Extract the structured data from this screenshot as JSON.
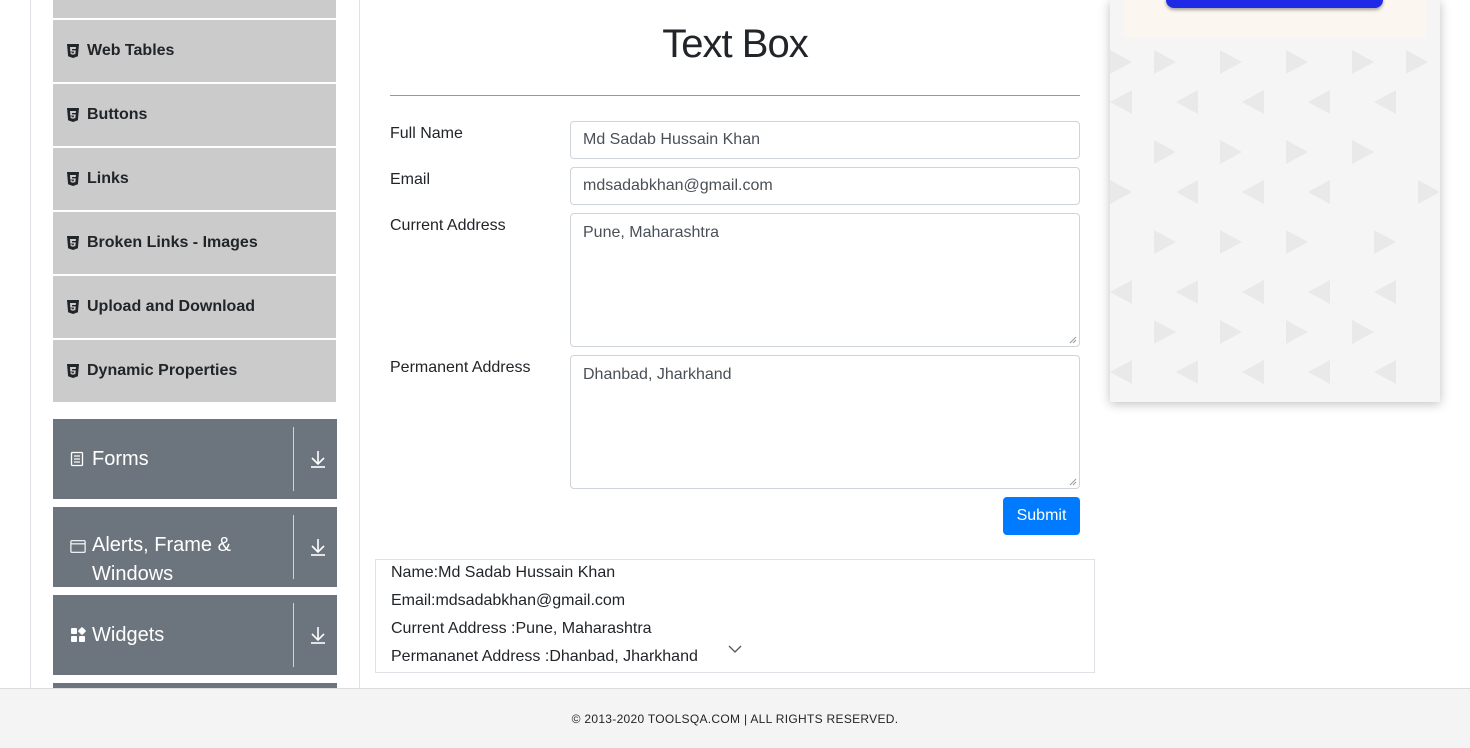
{
  "sidebar": {
    "items": [
      {
        "label": "Web Tables",
        "icon": "html5-icon"
      },
      {
        "label": "Buttons",
        "icon": "html5-icon"
      },
      {
        "label": "Links",
        "icon": "html5-icon"
      },
      {
        "label": "Broken Links - Images",
        "icon": "html5-icon"
      },
      {
        "label": "Upload and Download",
        "icon": "html5-icon"
      },
      {
        "label": "Dynamic Properties",
        "icon": "html5-icon"
      }
    ],
    "groups": [
      {
        "label": "Forms",
        "icon": "document-icon"
      },
      {
        "label_line1": "Alerts, Frame &",
        "label_line2": "Windows",
        "icon": "window-icon"
      },
      {
        "label": "Widgets",
        "icon": "widgets-grid-icon"
      }
    ]
  },
  "main": {
    "title": "Text Box",
    "form": {
      "full_name_label": "Full Name",
      "full_name_value": "Md Sadab Hussain Khan",
      "email_label": "Email",
      "email_value": "mdsadabkhan@gmail.com",
      "current_address_label": "Current Address",
      "current_address_value": "Pune, Maharashtra",
      "permanent_address_label": "Permanent Address",
      "permanent_address_value": "Dhanbad, Jharkhand",
      "submit_label": "Submit"
    },
    "output": {
      "name": "Name:Md Sadab Hussain Khan",
      "email": "Email:mdsadabkhan@gmail.com",
      "current_address": "Current Address :Pune, Maharashtra",
      "permanent_address": "Permananet Address :Dhanbad, Jharkhand"
    }
  },
  "footer": {
    "text": "© 2013-2020 TOOLSQA.COM | ALL RIGHTS RESERVED."
  },
  "colors": {
    "sidebar_item_bg": "#cbcbcb",
    "group_header_bg": "#6c757d",
    "submit_bg": "#007bff",
    "ad_button": "#1f2ae6"
  }
}
